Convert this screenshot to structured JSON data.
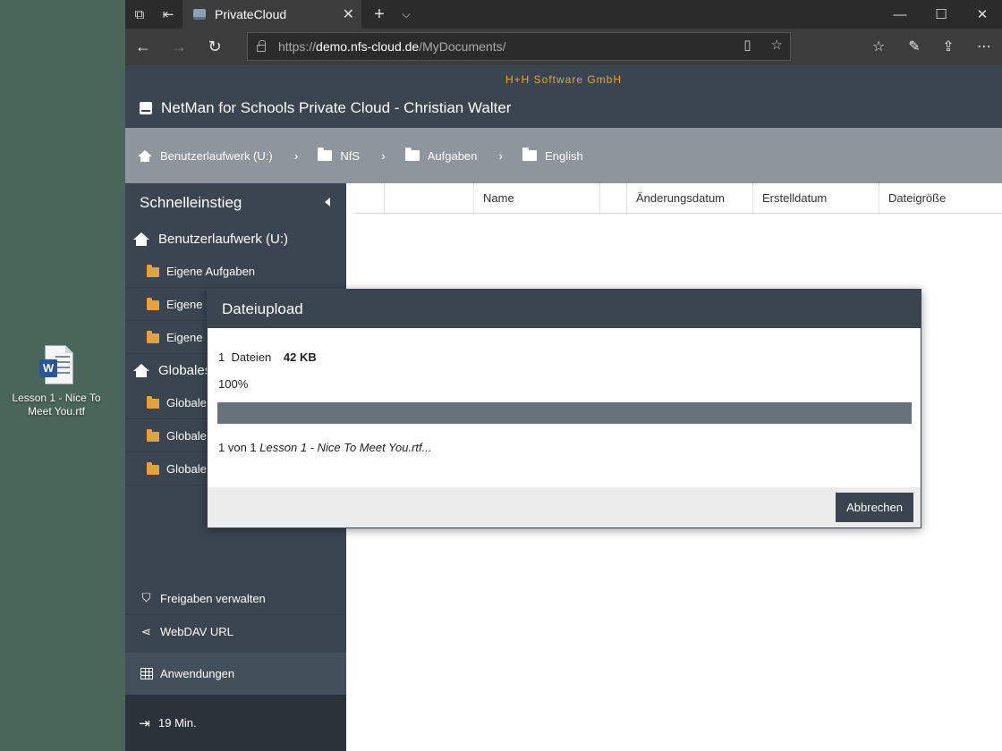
{
  "desktop": {
    "file_label": "Lesson 1 - Nice To Meet You.rtf",
    "file_icon": "word-document-icon"
  },
  "browser": {
    "tab_title": "PrivateCloud",
    "url_scheme": "https://",
    "url_host": "demo.nfs-cloud.de",
    "url_path": "/MyDocuments/"
  },
  "app": {
    "company": "H+H Software GmbH",
    "title": "NetMan for Schools Private Cloud - Christian Walter"
  },
  "breadcrumb": [
    {
      "label": "Benutzerlaufwerk (U:)",
      "icon": "home-icon"
    },
    {
      "label": "NfS",
      "icon": "folder-icon"
    },
    {
      "label": "Aufgaben",
      "icon": "folder-icon"
    },
    {
      "label": "English",
      "icon": "folder-icon"
    }
  ],
  "sidebar": {
    "title": "Schnelleinstieg",
    "groups": [
      {
        "label": "Benutzerlaufwerk (U:)",
        "items": [
          "Eigene Aufgaben",
          "Eigene C",
          "Eigene K"
        ]
      },
      {
        "label": "Globales",
        "items": [
          "Globale",
          "Globale",
          "Globale"
        ]
      }
    ],
    "shares": "Freigaben verwalten",
    "webdav": "WebDAV URL",
    "apps": "Anwendungen",
    "session": "19 Min."
  },
  "table": {
    "columns": [
      "",
      "",
      "Name",
      "",
      "Änderungsdatum",
      "Erstelldatum",
      "Dateigröße"
    ]
  },
  "dialog": {
    "title": "Dateiupload",
    "count": "1",
    "count_label": "Dateien",
    "size": "42 KB",
    "percent_text": "100%",
    "progress": 1.0,
    "status_prefix": "1 von 1",
    "status_file": "Lesson 1 - Nice To Meet You.rtf...",
    "cancel": "Abbrechen"
  },
  "colors": {
    "header": "#3a4550",
    "accent": "#e3a23b",
    "breadcrumb": "#8d969d",
    "progress": "#67727a"
  }
}
